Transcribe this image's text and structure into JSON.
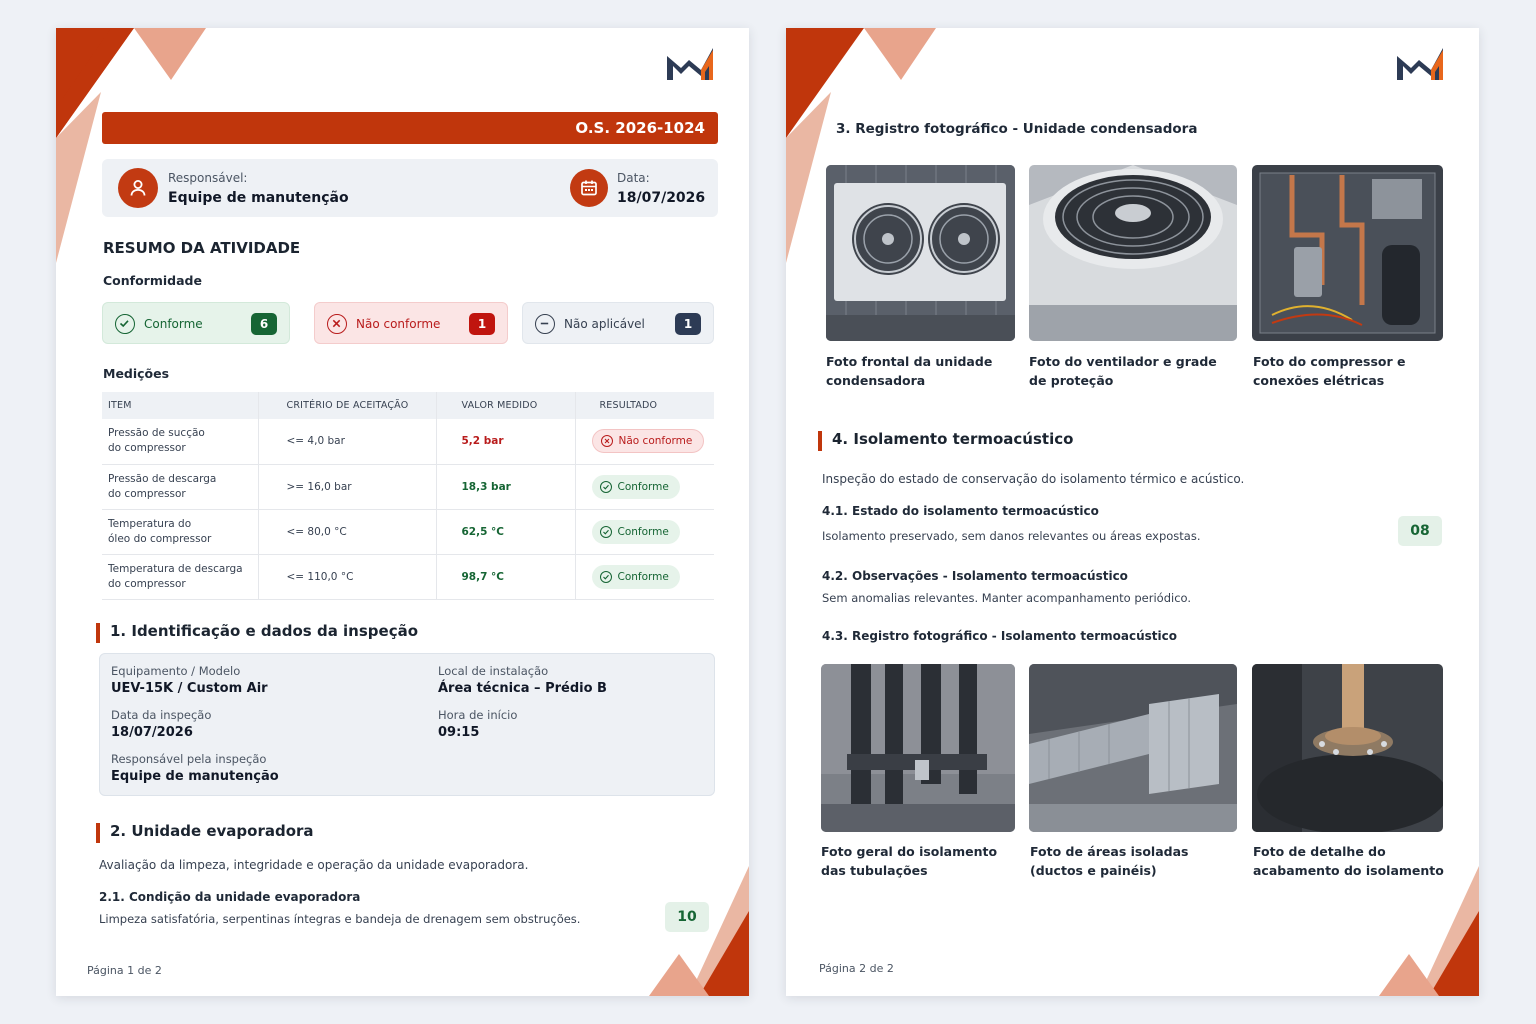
{
  "page1": {
    "os_number": "O.S. 2026-1024",
    "responsible_label": "Responsável:",
    "responsible_value": "Equipe de manutenção",
    "date_label": "Data:",
    "date_value": "18/07/2026",
    "summary_title": "RESUMO DA ATIVIDADE",
    "conformity_title": "Conformidade",
    "conformity": [
      {
        "label": "Conforme",
        "count": "6"
      },
      {
        "label": "Não conforme",
        "count": "1"
      },
      {
        "label": "Não aplicável",
        "count": "1"
      }
    ],
    "measurements_title": "Medições",
    "table_headers": [
      "ITEM",
      "CRITÉRIO DE ACEITAÇÃO",
      "VALOR MEDIDO",
      "RESULTADO"
    ],
    "rows": [
      {
        "item_l1": "Pressão de sucção",
        "item_l2": "do compressor",
        "criterion": "<= 4,0 bar",
        "value": "5,2 bar",
        "result": "Não conforme"
      },
      {
        "item_l1": "Pressão de descarga",
        "item_l2": "do compressor",
        "criterion": ">= 16,0 bar",
        "value": "18,3 bar",
        "result": "Conforme"
      },
      {
        "item_l1": "Temperatura do",
        "item_l2": "óleo do compressor",
        "criterion": "<= 80,0 °C",
        "value": "62,5 °C",
        "result": "Conforme"
      },
      {
        "item_l1": "Temperatura de descarga",
        "item_l2": "do compressor",
        "criterion": "<= 110,0 °C",
        "value": "98,7 °C",
        "result": "Conforme"
      }
    ],
    "section1_title": "1. Identificação e dados da inspeção",
    "id": {
      "equip_label": "Equipamento / Modelo",
      "equip_value": "UEV-15K / Custom Air",
      "local_label": "Local de instalação",
      "local_value": "Área técnica – Prédio B",
      "date_label": "Data da inspeção",
      "date_value": "18/07/2026",
      "time_label": "Hora de início",
      "time_value": "09:15",
      "resp_label": "Responsável pela inspeção",
      "resp_value": "Equipe de manutenção"
    },
    "section2_title": "2. Unidade evaporadora",
    "section2_desc": "Avaliação da limpeza, integridade e operação da unidade evaporadora.",
    "sub21_title": "2.1. Condição da unidade evaporadora",
    "sub21_text": "Limpeza satisfatória, serpentinas íntegras e bandeja de drenagem sem obstruções.",
    "sub21_score": "10",
    "page_number": "Página 1 de 2"
  },
  "page2": {
    "section3_title": "3. Registro fotográfico - Unidade condensadora",
    "photos_top": [
      {
        "l1": "Foto frontal da unidade",
        "l2": "condensadora"
      },
      {
        "l1": "Foto do ventilador e grade",
        "l2": "de proteção"
      },
      {
        "l1": "Foto do compressor e",
        "l2": "conexões elétricas"
      }
    ],
    "section4_title": "4. Isolamento termoacústico",
    "section4_desc": "Inspeção do estado de conservação do isolamento térmico e acústico.",
    "sub41_title": "4.1. Estado do isolamento termoacústico",
    "sub41_text": "Isolamento preservado, sem danos relevantes ou áreas expostas.",
    "sub41_score": "08",
    "sub42_title": "4.2. Observações - Isolamento termoacústico",
    "sub42_text": "Sem anomalias relevantes. Manter acompanhamento periódico.",
    "sub43_title": "4.3. Registro fotográfico - Isolamento termoacústico",
    "photos_bottom": [
      {
        "l1": "Foto geral do isolamento",
        "l2": "das tubulações"
      },
      {
        "l1": "Foto de áreas isoladas",
        "l2": "(ductos e painéis)"
      },
      {
        "l1": "Foto de detalhe do",
        "l2": "acabamento do isolamento"
      }
    ],
    "page_number": "Página 2 de 2"
  },
  "colors": {
    "accent": "#c0360c",
    "accent_light": "#e8a48c",
    "ok": "#166534",
    "nok": "#b91c1c",
    "navy": "#2d3b55"
  },
  "icons": [
    "user-icon",
    "calendar-icon",
    "check-circle-icon",
    "x-circle-icon",
    "minus-circle-icon",
    "brand-logo"
  ]
}
